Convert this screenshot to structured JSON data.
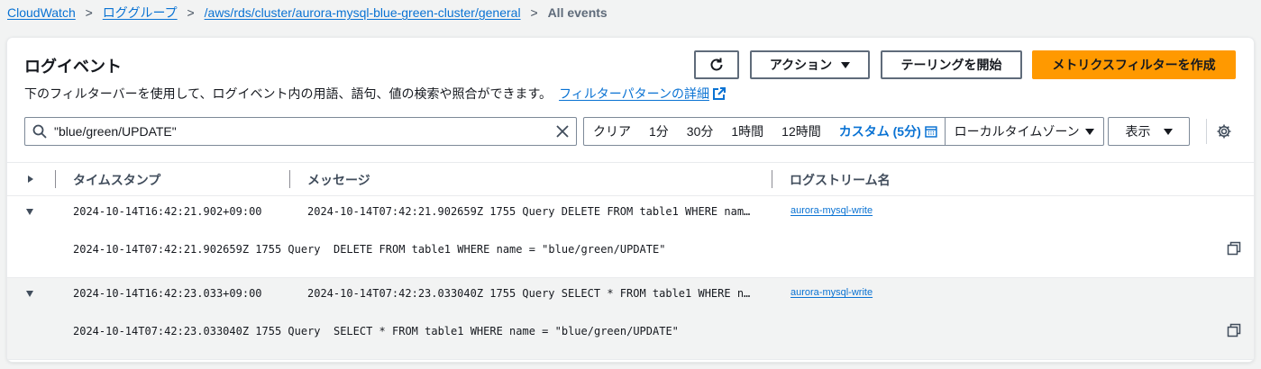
{
  "breadcrumb": {
    "items": [
      "CloudWatch",
      "ロググループ",
      "/aws/rds/cluster/aurora-mysql-blue-green-cluster/general"
    ],
    "separator": ">",
    "current": "All events"
  },
  "header": {
    "title": "ログイベント",
    "description": "下のフィルターバーを使用して、ログイベント内の用語、語句、値の検索や照合ができます。",
    "filter_pattern_link": "フィルターパターンの詳細"
  },
  "actions": {
    "refresh_icon": "refresh-icon",
    "actions_label": "アクション",
    "tailing_label": "テーリングを開始",
    "create_filter_label": "メトリクスフィルターを作成"
  },
  "search": {
    "value": "\"blue/green/UPDATE\""
  },
  "timerange": {
    "clear": "クリア",
    "options": [
      "1分",
      "30分",
      "1時間",
      "12時間"
    ],
    "custom": "カスタム (5分)",
    "timezone": "ローカルタイムゾーン"
  },
  "display_label": "表示",
  "colors": {
    "accent": "#0972d3",
    "primary": "#ff9900"
  },
  "table": {
    "headers": [
      "タイムスタンプ",
      "メッセージ",
      "ログストリーム名"
    ],
    "rows": [
      {
        "timestamp": "2024-10-14T16:42:21.902+09:00",
        "message": "2024-10-14T07:42:21.902659Z 1755 Query DELETE FROM table1 WHERE nam…",
        "stream": "aurora-mysql-write",
        "detail": "2024-10-14T07:42:21.902659Z 1755 Query  DELETE FROM table1 WHERE name = \"blue/green/UPDATE\""
      },
      {
        "timestamp": "2024-10-14T16:42:23.033+09:00",
        "message": "2024-10-14T07:42:23.033040Z 1755 Query SELECT * FROM table1 WHERE n…",
        "stream": "aurora-mysql-write",
        "detail": "2024-10-14T07:42:23.033040Z 1755 Query  SELECT * FROM table1 WHERE name = \"blue/green/UPDATE\""
      }
    ]
  }
}
